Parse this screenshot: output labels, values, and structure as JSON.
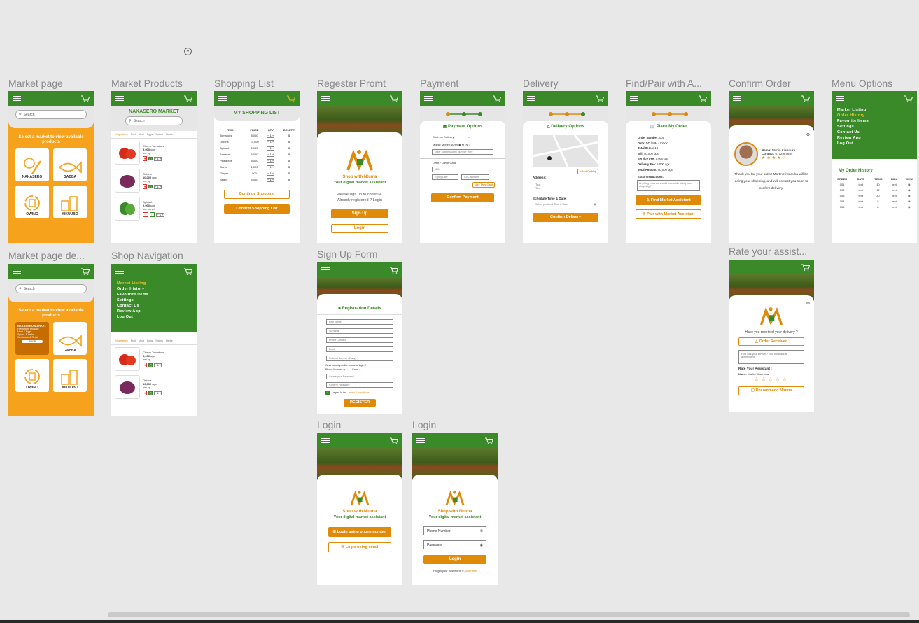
{
  "labels": {
    "market_page": "Market page",
    "market_products": "Market Products",
    "shopping_list": "Shopping List",
    "register_prompt": "Regester Promt",
    "payment": "Payment",
    "delivery": "Delivery",
    "find_pair": "Find/Pair with A...",
    "confirm_order": "Confirm Order",
    "menu_options": "Menu Options",
    "market_page_de": "Market page de...",
    "shop_navigation": "Shop Navigation",
    "sign_up_form": "Sign Up Form",
    "rate_assist": "Rate your assist...",
    "login1": "Login",
    "login2": "Login"
  },
  "market": {
    "search": "Search",
    "headline": "Select a market to view available products",
    "markets": [
      "NAKASERO",
      "GABBA",
      "OWINO",
      "KIKUUBO"
    ],
    "detail_title": "NAKASERO MARKET",
    "detail_lines": [
      "Fresh farm produce",
      "Meat & Eggs",
      "Spices & Herbs",
      "Wholesale & Retail"
    ],
    "shop": "SHOP"
  },
  "products": {
    "title": "NAKASERO MARKET",
    "search": "Search",
    "tabs": [
      "Vegetables",
      "Fruit",
      "Meat",
      "Eggs",
      "Spices",
      "Herbs"
    ],
    "items": [
      {
        "name": "Cherry Tomatoes",
        "price": "8,000",
        "unit": "ugx",
        "per": "per kg",
        "qty": "1"
      },
      {
        "name": "Onions",
        "price": "10,000",
        "unit": "ugx",
        "per": "per kg",
        "qty": "1"
      },
      {
        "name": "Spinach",
        "price": "2,000",
        "unit": "ugx",
        "per": "per bunch",
        "qty": "1"
      }
    ]
  },
  "shopping": {
    "title": "MY SHOPPING LIST",
    "headers": [
      "ITEM",
      "PRICE",
      "QTY",
      "DELETE"
    ],
    "rows": [
      [
        "Tomatoes",
        "8,000",
        "1"
      ],
      [
        "Onions",
        "10,000",
        "1"
      ],
      [
        "Spinach",
        "2,000",
        "1"
      ],
      [
        "Bananas",
        "5,000",
        "1"
      ],
      [
        "Pineapple",
        "8,000",
        "1"
      ],
      [
        "Garlic",
        "1,000",
        "1"
      ],
      [
        "Ginger",
        "500",
        "1"
      ],
      [
        "Beans",
        "5,000",
        "1"
      ]
    ],
    "continue": "Continue Shopping",
    "confirm": "Confirm Shopping List"
  },
  "register": {
    "brand": "Shop with Ntuma",
    "tagline": "Your digital market assistant",
    "msg1": "Please sign up to continue.",
    "msg2": "Already registered ? Login",
    "signup": "Sign Up",
    "login": "Login"
  },
  "payment": {
    "title": "Payment Options",
    "cash": "Cash on Delivery:",
    "mobile": "Mobile Money:",
    "airtel": "Airtel",
    "mtn": "MTN",
    "mobile_ph": "Enter Mobile Money Number Here",
    "card_label": "Debit / Credit Card",
    "card_ph": "1234",
    "expiry": "Expiry Date",
    "cvc": "CVC Number",
    "use_card": "Use This Card",
    "confirm": "Confirm Payment"
  },
  "delivery": {
    "title": "Delivery Options",
    "select_map": "Select On Map",
    "address": "Address:",
    "addr_text1": "Text",
    "addr_text2": "Text",
    "schedule": "Schedule Time & Date:",
    "schedule_ph": "Select preffered Time & Date",
    "confirm": "Confirm Delivery"
  },
  "order": {
    "title": "Place My Order",
    "lines": [
      [
        "Order Number:",
        "001"
      ],
      [
        "Date:",
        "DD / MM / YYYY"
      ],
      [
        "Total Items:",
        "10"
      ],
      [
        "Bill:",
        "50,000 ugx"
      ],
      [
        "Service Fee:",
        "5,000 ugx"
      ],
      [
        "Delivery Fee:",
        "5,000 ugx"
      ],
      [
        "Total Amount:",
        "60,000 ugx"
      ]
    ],
    "extra": "Extra Instructions:",
    "extra_ph": "Anything extra we should note while doing your shopping ?",
    "find": "Find Market Assistant",
    "pair": "Pair with Market Assistant"
  },
  "confirm": {
    "name_label": "Name:",
    "name": "Martin Kiwanuka",
    "contact_label": "Contact:",
    "contact": "0772987654",
    "message": "Thank you for your order! Martin Kiwanuka will be doing your shopping, and will contact you soon to confirm delivery."
  },
  "menu": {
    "items": [
      "Market Listing",
      "Order History",
      "Favourite Items",
      "Settings",
      "Contact Us",
      "Review App",
      "Log Out"
    ],
    "history_title": "My Order History",
    "headers": [
      "ORDER",
      "DATE",
      "ITEMS",
      "BILL",
      "VIEW"
    ],
    "rows": [
      [
        "001",
        "text",
        "10",
        "text"
      ],
      [
        "002",
        "text",
        "12",
        "text"
      ],
      [
        "003",
        "text",
        "30",
        "text"
      ],
      [
        "004",
        "text",
        "5",
        "text"
      ],
      [
        "005",
        "text",
        "8",
        "text"
      ]
    ]
  },
  "signup": {
    "title": "Registration Details",
    "fields": [
      "First Name",
      "Surname",
      "Phone Contact",
      "Email",
      "Referral Number (if any)"
    ],
    "question": "What would you like to use to login ?",
    "phone": "Phone Number",
    "email": "Email",
    "pass": "Create your Password",
    "confirm_pass": "Confirm Password",
    "agree": "I agree to the",
    "terms": "terms & conditions",
    "register": "REGISTER"
  },
  "rate": {
    "question": "Have you received your delivery ?",
    "received": "Order Received",
    "feedback_ph": "How was your service ? Your feedback is appreciated.",
    "rate_label": "Rate Your Assistant :",
    "name_label": "Name:",
    "name": "Martin Kiwanuka",
    "recommend": "Recommend Ntuma"
  },
  "login": {
    "brand": "Shop with Ntuma",
    "tagline": "Your digital market assistant",
    "by_phone": "Login using phone number",
    "by_email": "Login using email",
    "phone_ph": "Phone Number",
    "pass_ph": "Password",
    "login": "Login",
    "forgot": "Forgot your password ?",
    "click": "Click Here"
  },
  "colors": {
    "green": "#3a8a2a",
    "orange": "#e08a0a",
    "market_orange": "#f7a21c"
  }
}
